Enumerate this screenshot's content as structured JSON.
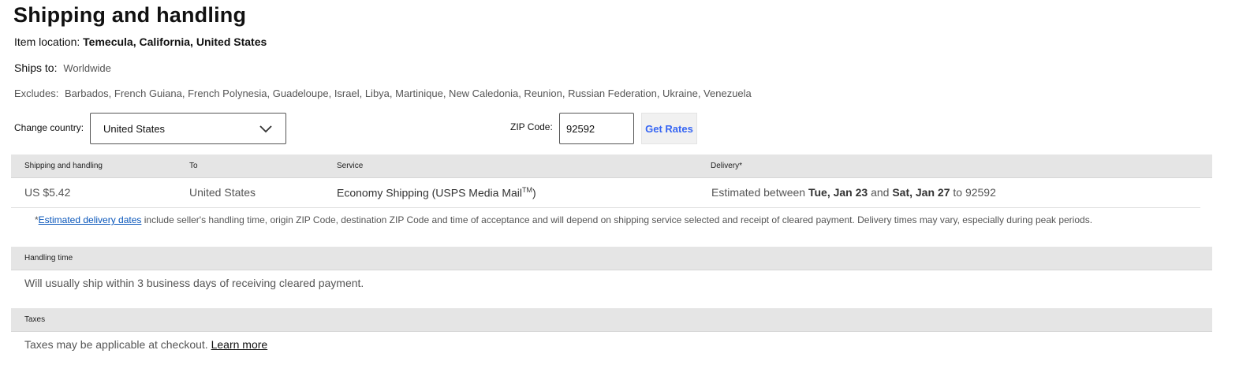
{
  "title": "Shipping and handling",
  "item_location": {
    "label": "Item location:",
    "value": "Temecula, California, United States"
  },
  "ships_to": {
    "label": "Ships to:",
    "value": "Worldwide"
  },
  "excludes": {
    "label": "Excludes:",
    "value": "Barbados, French Guiana, French Polynesia, Guadeloupe, Israel, Libya, Martinique, New Caledonia, Reunion, Russian Federation, Ukraine, Venezuela"
  },
  "change_country": {
    "label": "Change country:",
    "selected": "United States"
  },
  "zip": {
    "label": "ZIP Code:",
    "value": "92592"
  },
  "get_rates_label": "Get Rates",
  "shipping_table": {
    "headers": {
      "shipping": "Shipping and handling",
      "to": "To",
      "service": "Service",
      "delivery": "Delivery*"
    },
    "row": {
      "price": "US $5.42",
      "to": "United States",
      "service_main": "Economy Shipping (USPS Media Mail",
      "service_tm": "TM",
      "service_close": ")",
      "delivery_prefix": "Estimated between",
      "date_start": "Tue, Jan 23",
      "and": "and",
      "date_end": "Sat, Jan 27",
      "to_word": "to",
      "zip": "92592"
    },
    "note_asterisk": "*",
    "note_link": "Estimated delivery dates",
    "note_text": "include seller's handling time, origin ZIP Code, destination ZIP Code and time of acceptance and will depend on shipping service selected and receipt of cleared payment. Delivery times may vary, especially during peak periods."
  },
  "handling": {
    "header": "Handling time",
    "text": "Will usually ship within 3 business days of receiving cleared payment."
  },
  "taxes": {
    "header": "Taxes",
    "text": "Taxes may be applicable at checkout.",
    "link": "Learn more"
  },
  "icons": {
    "dropdown": "chevron-down-icon"
  }
}
